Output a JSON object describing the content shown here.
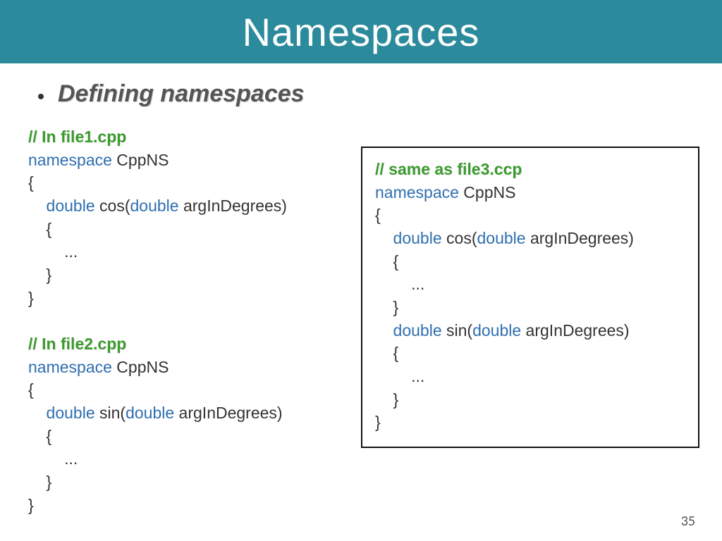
{
  "header": {
    "title": "Namespaces"
  },
  "bullet": {
    "text": "Defining namespaces"
  },
  "left": {
    "c1": "// In file1.cpp",
    "l2a": "namespace",
    "l2b": " CppNS",
    "l3": "{",
    "l4a": "    DOUBLE",
    "l4b": " COS(",
    "l4c": "DOUBLE",
    "l4d": " ARGINDEGREES)",
    "l5": "    {",
    "l6": "        ...",
    "l7": "    }",
    "l8": "}",
    "c2": "// In file2.cpp",
    "m2a": "namespace",
    "m2b": " CppNS",
    "m3": "{",
    "m4a": "    DOUBLE",
    "m4b": " SIN(",
    "m4c": "DOUBLE",
    "m4d": " ARGINDEGREES)",
    "m5": "    {",
    "m6": "        ...",
    "m7": "    }",
    "m8": "}"
  },
  "right": {
    "c1": "// same as file3.ccp",
    "l2a": "namespace",
    "l2b": " CppNS",
    "l3": "{",
    "l4a": "    DOUBLE",
    "l4b": " COS(",
    "l4c": "DOUBLE",
    "l4d": " ARGINDEGREES)",
    "l5": "    {",
    "l6": "        ...",
    "l7": "    }",
    "l8a": "    DOUBLE",
    "l8b": " SIN(",
    "l8c": "DOUBLE",
    "l8d": " ARGINDEGREES)",
    "l9": "    {",
    "l10": "        ...",
    "l11": "    }",
    "l12": "}"
  },
  "page": {
    "number": "35"
  }
}
